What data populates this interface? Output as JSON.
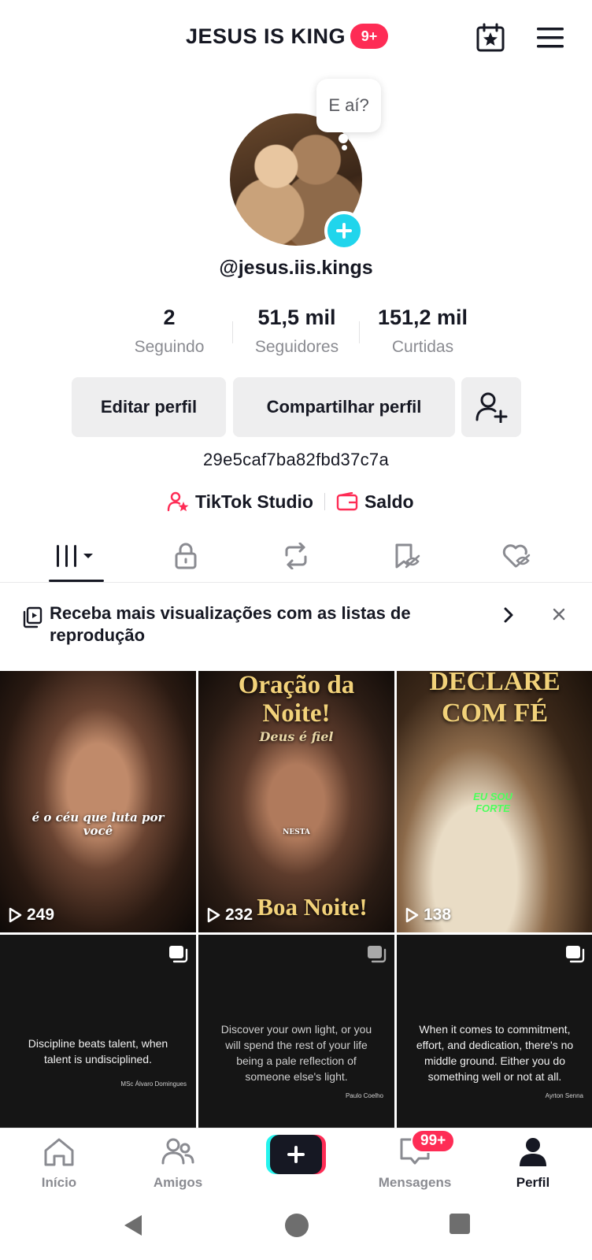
{
  "header": {
    "title": "JESUS IS KING",
    "notifications_badge": "9+",
    "calendar_icon": "calendar-star-icon",
    "menu_icon": "hamburger-menu-icon"
  },
  "profile": {
    "bubble_text": "E aí?",
    "username": "@jesus.iis.kings",
    "bio": "29e5caf7ba82fbd37c7a"
  },
  "stats": [
    {
      "value": "2",
      "label": "Seguindo"
    },
    {
      "value": "51,5 mil",
      "label": "Seguidores"
    },
    {
      "value": "151,2 mil",
      "label": "Curtidas"
    }
  ],
  "actions": {
    "edit": "Editar perfil",
    "share": "Compartilhar perfil",
    "add_friend_icon": "add-user-icon"
  },
  "links": {
    "studio": "TikTok Studio",
    "balance": "Saldo"
  },
  "tabs": [
    "videos",
    "private",
    "reposts",
    "favorites",
    "liked"
  ],
  "promo": {
    "text": "Receba mais visualizações com as listas de reprodução"
  },
  "videos": [
    {
      "views": "249",
      "caption": "é o céu que luta por você"
    },
    {
      "views": "232",
      "title_top": "Oração da Noite!",
      "subtitle": "Deus é fiel",
      "middle": "NESTA",
      "title_bottom": "Boa Noite!"
    },
    {
      "views": "138",
      "title_top": "DECLARE COM FÉ",
      "highlight": "EU SOU FORTE"
    }
  ],
  "quotes": [
    {
      "text": "Discipline beats talent, when talent is undisciplined.",
      "author": "MSc Álvaro Domingues"
    },
    {
      "text": "Discover your own light, or you will spend the rest of your life being a pale reflection of someone else's light.",
      "author": "Paulo Coelho"
    },
    {
      "text": "When it comes to commitment, effort, and dedication, there's no middle ground. Either you do something well or not at all.",
      "author": "Ayrton Senna"
    }
  ],
  "bottom_nav": {
    "home": "Início",
    "friends": "Amigos",
    "messages": "Mensagens",
    "messages_badge": "99+",
    "profile": "Perfil"
  },
  "colors": {
    "brand_red": "#fe2c55",
    "brand_cyan": "#25f4ee",
    "add_button": "#20d5ec"
  }
}
